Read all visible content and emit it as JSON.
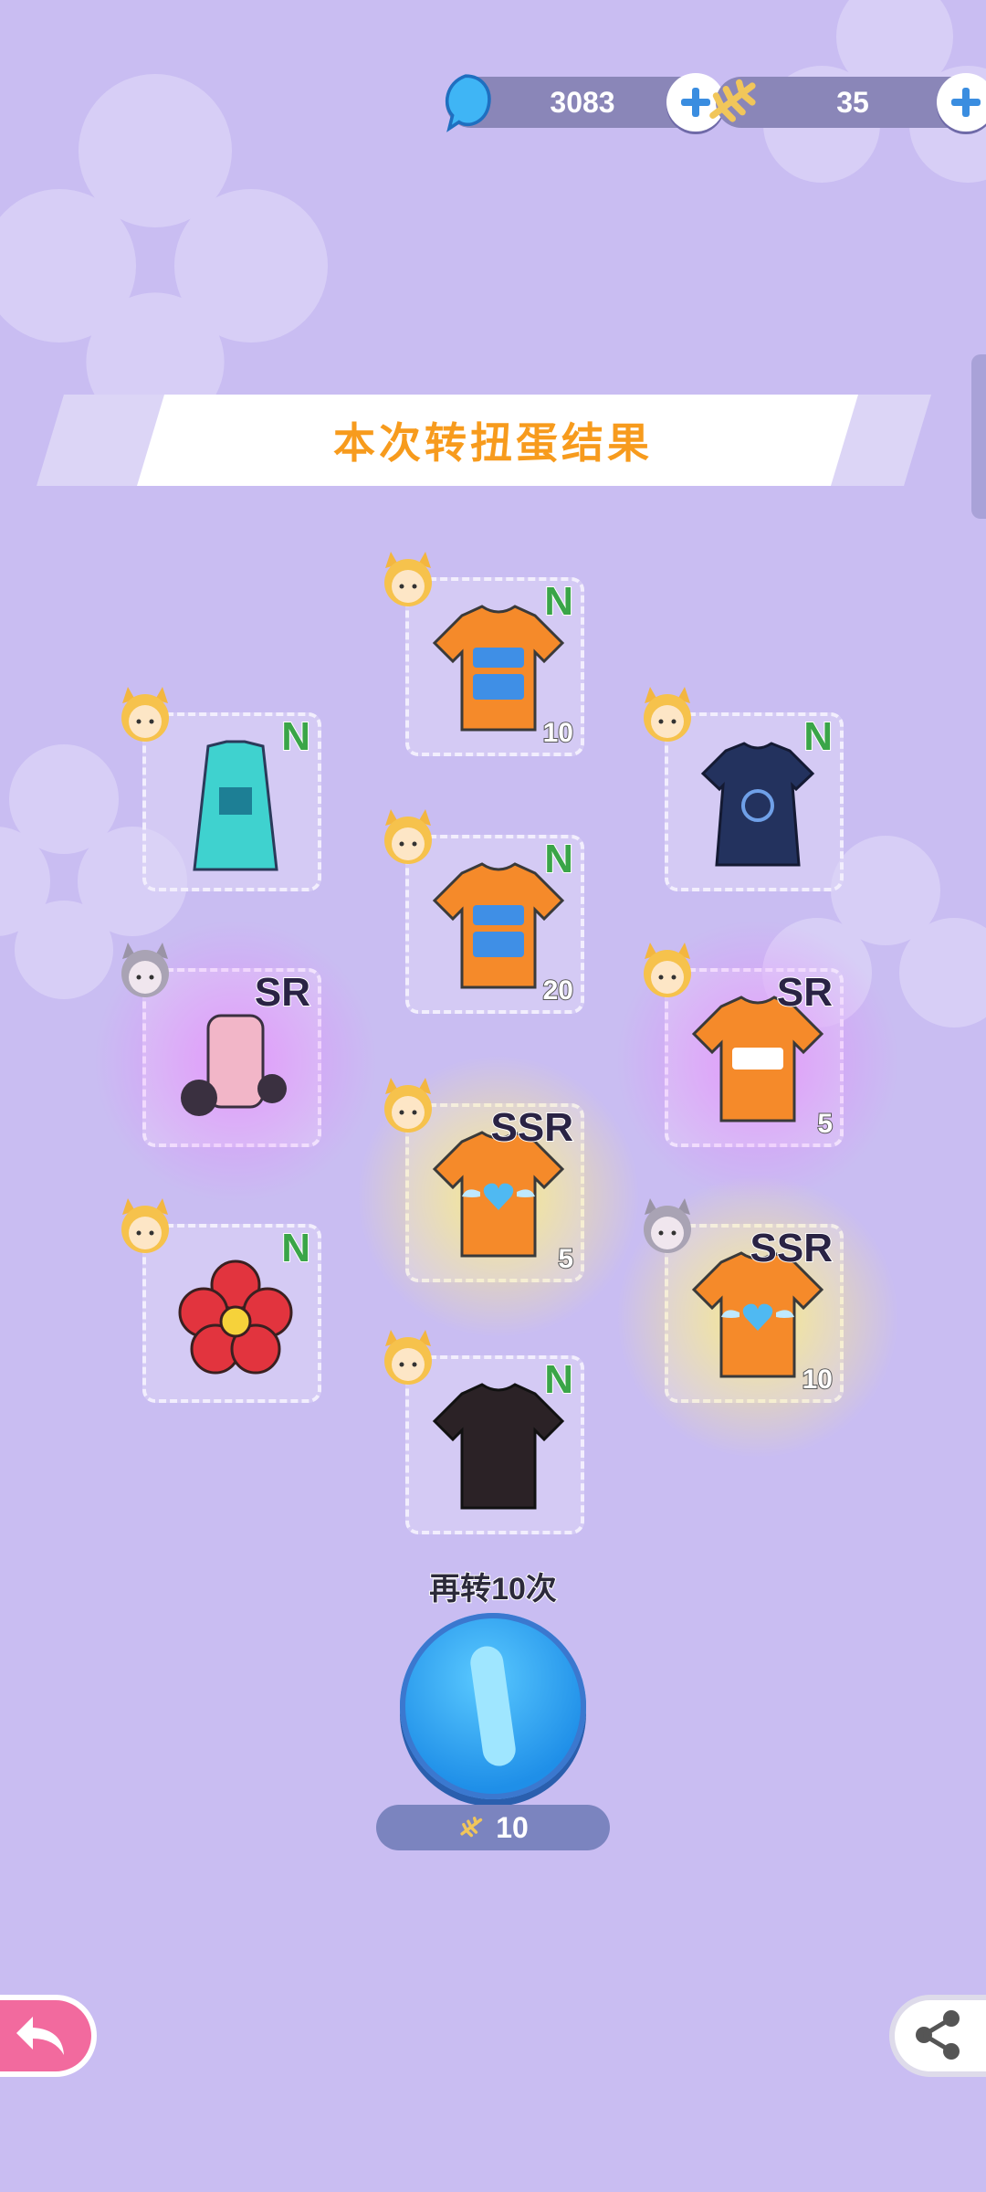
{
  "currencies": [
    {
      "name": "gem",
      "value": "3083",
      "icon": "blue-gem-icon"
    },
    {
      "name": "fishbone",
      "value": "35",
      "icon": "fishbone-icon"
    }
  ],
  "banner": {
    "title": "本次转扭蛋结果"
  },
  "results": [
    {
      "rarity": "N",
      "count": "10",
      "item": "orange-tshirt"
    },
    {
      "rarity": "N",
      "count": "",
      "item": "teal-jersey-dress"
    },
    {
      "rarity": "N",
      "count": "",
      "item": "navy-taurus-dress"
    },
    {
      "rarity": "N",
      "count": "20",
      "item": "orange-tshirt"
    },
    {
      "rarity": "SR",
      "count": "",
      "item": "pink-mecha-outfit"
    },
    {
      "rarity": "SR",
      "count": "5",
      "item": "neko-orange-tshirt"
    },
    {
      "rarity": "SSR",
      "count": "5",
      "item": "angel-heart-tshirt"
    },
    {
      "rarity": "N",
      "count": "",
      "item": "red-flower"
    },
    {
      "rarity": "SSR",
      "count": "10",
      "item": "angel-heart-tshirt"
    },
    {
      "rarity": "N",
      "count": "",
      "item": "black-tshirt"
    }
  ],
  "spin": {
    "label": "再转10次",
    "cost": "10"
  },
  "colors": {
    "background": "#c9bdf2",
    "title": "#f79b1d",
    "n": "#3aa548",
    "button": "#2a9df0"
  }
}
